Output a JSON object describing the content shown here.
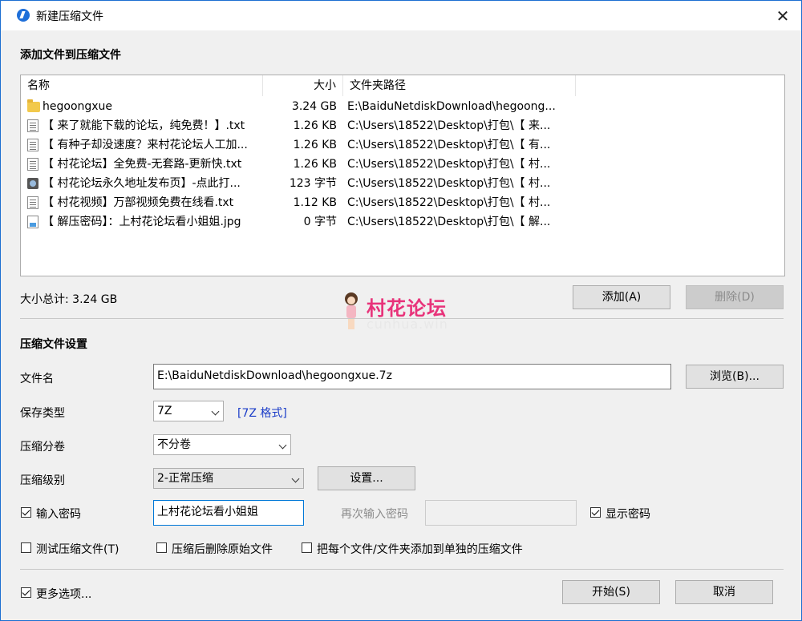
{
  "window": {
    "title": "新建压缩文件"
  },
  "add_section": {
    "title": "添加文件到压缩文件"
  },
  "list": {
    "columns": [
      "名称",
      "大小",
      "文件夹路径"
    ],
    "rows": [
      {
        "icon": "folder-icon",
        "name": "hegoongxue",
        "size": "3.24 GB",
        "path": "E:\\BaiduNetdiskDownload\\hegoong..."
      },
      {
        "icon": "text-file-icon",
        "name": "【 来了就能下载的论坛，纯免费！】.txt",
        "size": "1.26 KB",
        "path": "C:\\Users\\18522\\Desktop\\打包\\【 来..."
      },
      {
        "icon": "text-file-icon",
        "name": "【 有种子却没速度？来村花论坛人工加...",
        "size": "1.26 KB",
        "path": "C:\\Users\\18522\\Desktop\\打包\\【 有..."
      },
      {
        "icon": "text-file-icon",
        "name": "【 村花论坛】全免费-无套路-更新快.txt",
        "size": "1.26 KB",
        "path": "C:\\Users\\18522\\Desktop\\打包\\【 村..."
      },
      {
        "icon": "url-file-icon",
        "name": "【 村花论坛永久地址发布页】-点此打...",
        "size": "123 字节",
        "path": "C:\\Users\\18522\\Desktop\\打包\\【 村..."
      },
      {
        "icon": "text-file-icon",
        "name": "【 村花视频】万部视频免费在线看.txt",
        "size": "1.12 KB",
        "path": "C:\\Users\\18522\\Desktop\\打包\\【 村..."
      },
      {
        "icon": "image-file-icon",
        "name": "【 解压密码】：上村花论坛看小姐姐.jpg",
        "size": "0 字节",
        "path": "C:\\Users\\18522\\Desktop\\打包\\【 解..."
      }
    ]
  },
  "total_size": "大小总计: 3.24 GB",
  "buttons": {
    "add": "添加(A)",
    "delete": "删除(D)",
    "browse": "浏览(B)...",
    "settings": "设置...",
    "start": "开始(S)",
    "cancel": "取消"
  },
  "watermark": {
    "title": "村花论坛",
    "subtitle": "cunhua.win"
  },
  "settings_section": {
    "title": "压缩文件设置",
    "filename_label": "文件名",
    "filename_value": "E:\\BaiduNetdiskDownload\\hegoongxue.7z",
    "save_type_label": "保存类型",
    "save_type_value": "7Z",
    "format_link": "[7Z 格式]",
    "split_label": "压缩分卷",
    "split_value": "不分卷",
    "level_label": "压缩级别",
    "level_value": "2-正常压缩",
    "password_label": "输入密码",
    "password_checked": true,
    "password_value": "上村花论坛看小姐姐",
    "repeat_password_label": "再次输入密码",
    "repeat_password_value": "",
    "show_password_label": "显示密码",
    "show_password_checked": true
  },
  "options": {
    "test_label": "测试压缩文件(T)",
    "test_checked": false,
    "delete_after_label": "压缩后删除原始文件",
    "delete_after_checked": false,
    "each_separate_label": "把每个文件/文件夹添加到单独的压缩文件",
    "each_separate_checked": false,
    "more_options_label": "更多选项...",
    "more_options_checked": true
  }
}
